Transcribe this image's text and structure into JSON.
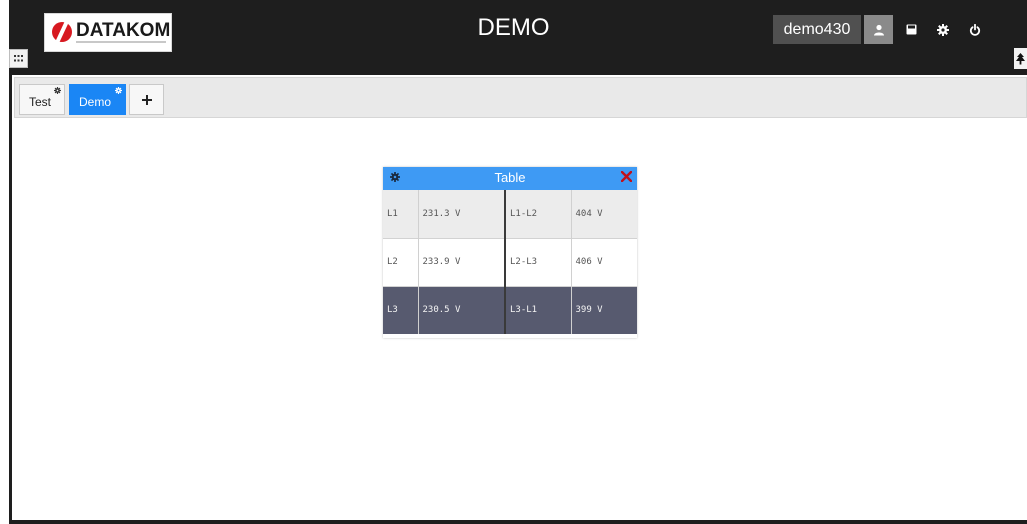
{
  "app": {
    "title": "DEMO"
  },
  "brand": {
    "logo_text": "DATAKOM"
  },
  "user": {
    "name": "demo430"
  },
  "header_buttons": [
    {
      "icon": "user-icon"
    },
    {
      "icon": "save-icon"
    },
    {
      "icon": "gear-icon"
    },
    {
      "icon": "power-icon"
    }
  ],
  "tabs": [
    {
      "label": "Test",
      "active": false
    },
    {
      "label": "Demo",
      "active": true
    }
  ],
  "add_tab_icon": "plus-icon",
  "widget": {
    "title": "Table",
    "rows": [
      [
        "L1",
        "231.3 V",
        "L1-L2",
        "404 V"
      ],
      [
        "L2",
        "233.9 V",
        "L2-L3",
        "406 V"
      ],
      [
        "L3",
        "230.5 V",
        "L3-L1",
        "399 V"
      ]
    ]
  },
  "colors": {
    "topbar": "#1e1e1e",
    "accent": "#1a86f5",
    "widget_header": "#3e9af4",
    "close": "#c0101a",
    "highlight_row": "#575a6f"
  }
}
